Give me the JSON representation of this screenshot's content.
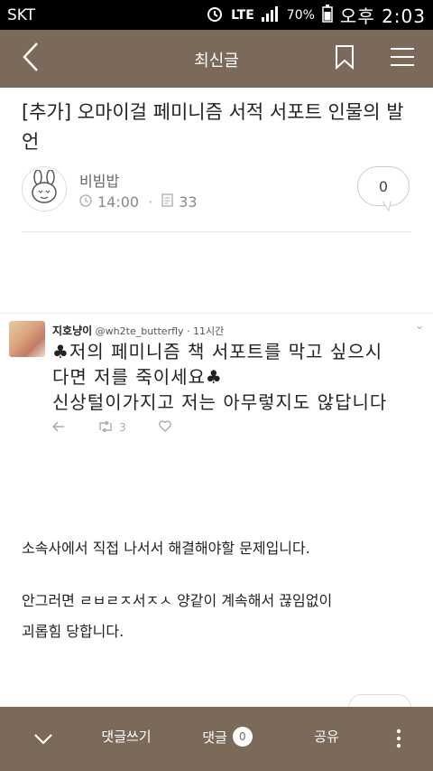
{
  "status_bar": {
    "carrier": "SKT",
    "network": "LTE",
    "battery": "70%",
    "time": "오후 2:03"
  },
  "app_bar": {
    "title": "최신글",
    "icons": [
      "back-arrow-icon",
      "bookmark-icon",
      "hamburger-menu-icon"
    ]
  },
  "post": {
    "title": "[추가] 오마이걸 페미니즘 서적 서포트 인물의 발언",
    "author": "비빔밥",
    "time": "14:00",
    "views": "33",
    "comment_count": "0"
  },
  "tweet": {
    "display_name": "지호냥이",
    "handle": "@wh2te_butterfly",
    "age": "11시간",
    "line1": "♣저의 페미니즘 책 서포트를 막고 싶으시",
    "line2": "다면 저를 죽이세요♣",
    "line3": "신상털이가지고 저는 아무렇지도 않답니다",
    "retweets": "3"
  },
  "body": {
    "para1": "소속사에서 직접 나서서 해결해야할 문제입니다.",
    "para2_line1": "안그러면 ㄹㅂㄹㅈ서ㅈㅅ 양같이 계속해서 끊임없이",
    "para2_line2": "괴롭힘 당합니다."
  },
  "bottom_bar": {
    "write_comment": "댓글쓰기",
    "comments": "댓글",
    "comment_count": "0",
    "share": "공유"
  },
  "colors": {
    "brand_brown": "#7b6a5a"
  }
}
